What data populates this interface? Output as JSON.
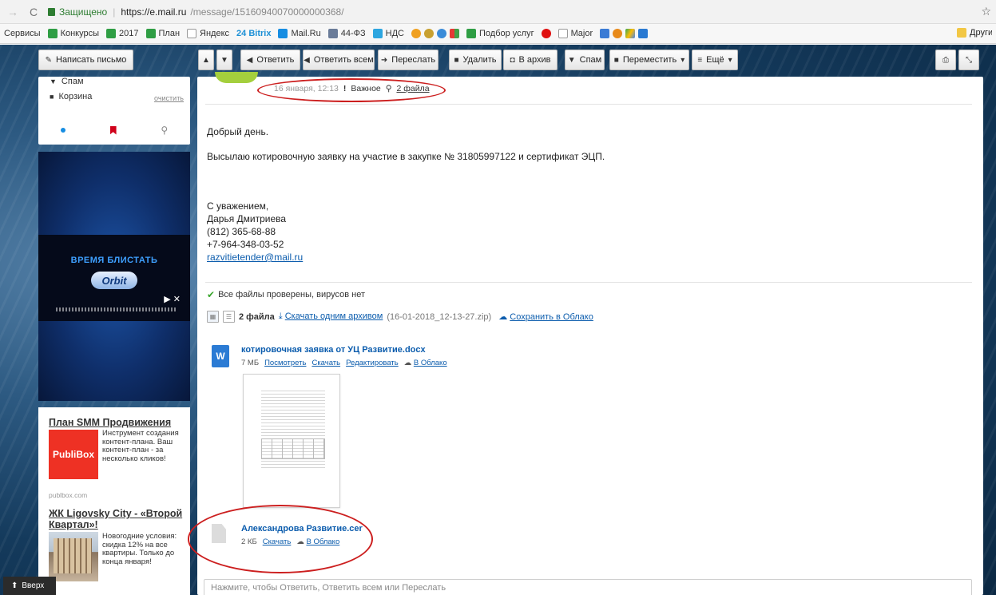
{
  "browser": {
    "secure_label": "Защищено",
    "url_main": "https://e.mail.ru",
    "url_rest": "/message/15160940070000000368/"
  },
  "bookmarks": {
    "items": [
      {
        "label": "Сервисы",
        "color": ""
      },
      {
        "label": "Конкурсы",
        "color": "#2f9e44"
      },
      {
        "label": "2017",
        "color": "#2f9e44"
      },
      {
        "label": "План",
        "color": "#2f9e44"
      },
      {
        "label": "Яндекс",
        "color": "#999999"
      },
      {
        "label": "24 Bitrix",
        "color": "#1c90d6"
      },
      {
        "label": "Mail.Ru",
        "color": "#168de2"
      },
      {
        "label": "44-ФЗ",
        "color": "#6a7c99"
      },
      {
        "label": "НДС",
        "color": "#2da6e0"
      },
      {
        "label": "Подбор услуг",
        "color": "#2f9e44"
      },
      {
        "label": "Major",
        "color": "#999999"
      }
    ],
    "other_label": "Другие закладки"
  },
  "toolbar": {
    "compose": "Написать письмо",
    "reply": "Ответить",
    "reply_all": "Ответить всем",
    "forward": "Переслать",
    "delete": "Удалить",
    "archive": "В архив",
    "spam": "Спам",
    "move": "Переместить",
    "more": "Ещё"
  },
  "folders": {
    "spam": "Спам",
    "trash": "Корзина",
    "clear": "очистить"
  },
  "banner": {
    "title": "ВРЕМЯ БЛИСТАТЬ",
    "logo": "Orbit"
  },
  "ads": [
    {
      "title": "План SMM Продвижения",
      "logo": "PubliBox",
      "text": "Инструмент создания контент-плана. Ваш контент-план - за несколько кликов!",
      "source": "publbox.com"
    },
    {
      "title": "ЖК Ligovsky City - «Второй Квартал»!",
      "text": "Новогодние условия: скидка 12% на все квартиры. Только до конца января!"
    }
  ],
  "up_button": "Вверх",
  "message": {
    "date": "16 января, 12:13",
    "important_mark": "!",
    "important": "Важное",
    "attach_count": "2 файла",
    "greeting": "Добрый день.",
    "body": "Высылаю котировочную заявку на участие в закупке № 31805997122 и сертификат ЭЦП.",
    "signature": {
      "regards": "С уважением,",
      "name": "Дарья Дмитриева",
      "phone1": "(812) 365-68-88",
      "phone2": "+7-964-348-03-52",
      "email": "razvitietender@mail.ru"
    },
    "virus_check": "Все файлы проверены, вирусов нет",
    "attachments_header": {
      "count": "2 файла",
      "download_all": "Скачать одним архивом",
      "archive_name": "(16-01-2018_12-13-27.zip)",
      "save_cloud": "Сохранить в Облако"
    },
    "files": [
      {
        "name": "котировочная заявка от УЦ Развитие.docx",
        "icon": "W",
        "size": "7 МБ",
        "actions": [
          "Посмотреть",
          "Скачать",
          "Редактировать"
        ],
        "cloud": "В Облако"
      },
      {
        "name": "Александрова Развитие.cer",
        "size": "2 КБ",
        "actions": [
          "Скачать"
        ],
        "cloud": "В Облако"
      }
    ],
    "reply_placeholder": "Нажмите, чтобы Ответить, Ответить всем или Переслать"
  },
  "colors": {
    "link": "#0b5cad",
    "annotation": "#cc1f1f",
    "avatar": "#a4cf3d"
  }
}
